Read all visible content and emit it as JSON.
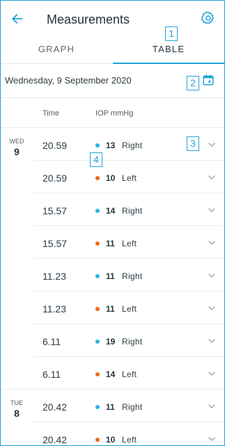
{
  "header": {
    "title": "Measurements",
    "back_icon": "arrow-left-icon",
    "settings_icon": "gear-icon"
  },
  "tabs": [
    {
      "label": "GRAPH",
      "active": false
    },
    {
      "label": "TABLE",
      "active": true
    }
  ],
  "date_bar": {
    "date": "Wednesday, 9 September 2020",
    "icon": "calendar-icon"
  },
  "table": {
    "headers": {
      "time": "Time",
      "iop": "IOP mmHg"
    },
    "rows": [
      {
        "dow": "WED",
        "day": "9",
        "time": "20.59",
        "value": "13",
        "eye": "Right"
      },
      {
        "dow": "",
        "day": "",
        "time": "20.59",
        "value": "10",
        "eye": "Left"
      },
      {
        "dow": "",
        "day": "",
        "time": "15.57",
        "value": "14",
        "eye": "Right"
      },
      {
        "dow": "",
        "day": "",
        "time": "15.57",
        "value": "11",
        "eye": "Left"
      },
      {
        "dow": "",
        "day": "",
        "time": "11.23",
        "value": "11",
        "eye": "Right"
      },
      {
        "dow": "",
        "day": "",
        "time": "11.23",
        "value": "11",
        "eye": "Left"
      },
      {
        "dow": "",
        "day": "",
        "time": "6.11",
        "value": "19",
        "eye": "Right"
      },
      {
        "dow": "",
        "day": "",
        "time": "6.11",
        "value": "14",
        "eye": "Left"
      },
      {
        "dow": "TUE",
        "day": "8",
        "time": "20.42",
        "value": "11",
        "eye": "Right"
      },
      {
        "dow": "",
        "day": "",
        "time": "20.42",
        "value": "10",
        "eye": "Left"
      }
    ]
  },
  "markers": [
    "1",
    "2",
    "3",
    "4"
  ],
  "colors": {
    "accent": "#1fa3d6",
    "right_eye": "#2bb3ea",
    "left_eye": "#f06a14"
  }
}
